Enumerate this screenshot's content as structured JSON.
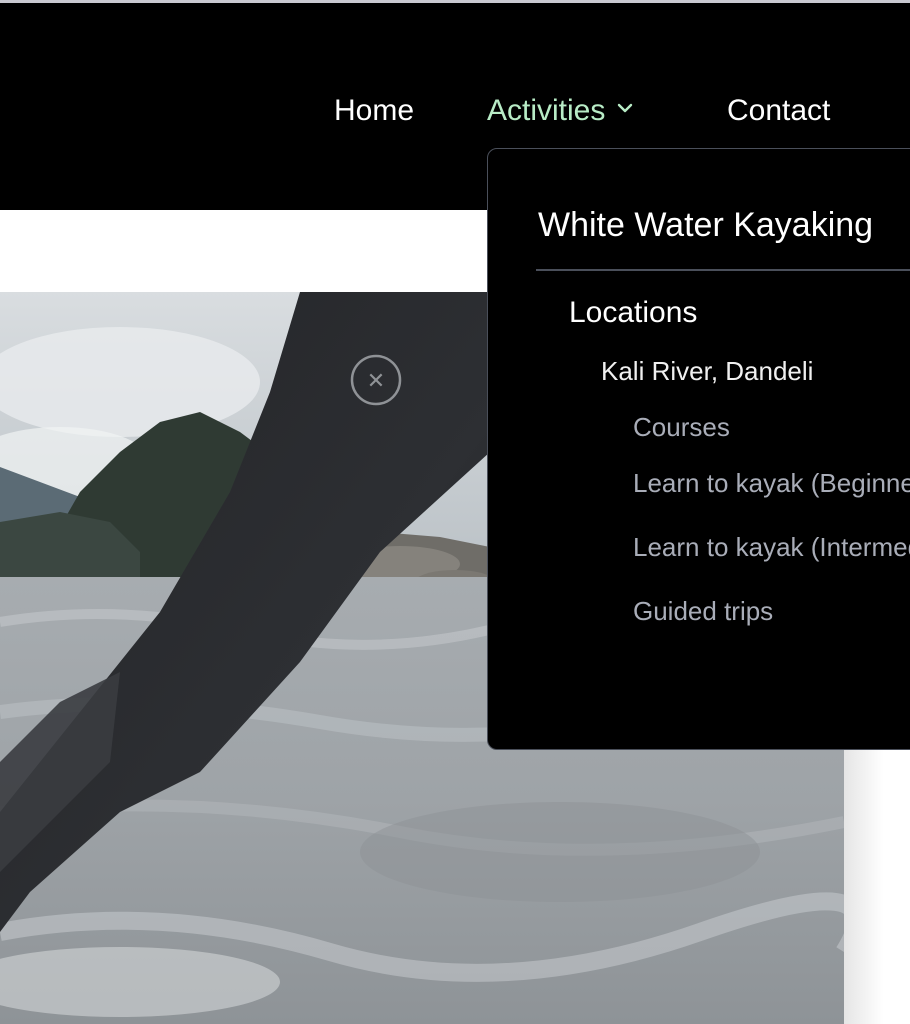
{
  "nav": {
    "home_label": "Home",
    "activities_label": "Activities",
    "contact_label": "Contact",
    "active_color": "#b8ecc6"
  },
  "dropdown": {
    "heading": "White Water Kayaking",
    "locations_label": "Locations",
    "location_name": "Kali River, Dandeli",
    "courses_label": "Courses",
    "items": [
      {
        "label": "Learn to kayak (Beginner)"
      },
      {
        "label": "Learn to kayak (Intermediate)"
      },
      {
        "label": "Guided trips"
      }
    ]
  },
  "hero": {
    "icon": "kayak-paddle-river-photo"
  },
  "colors": {
    "header_bg": "#000000",
    "dropdown_border": "#4a4f5a",
    "submenu_text": "#a9adb8"
  }
}
